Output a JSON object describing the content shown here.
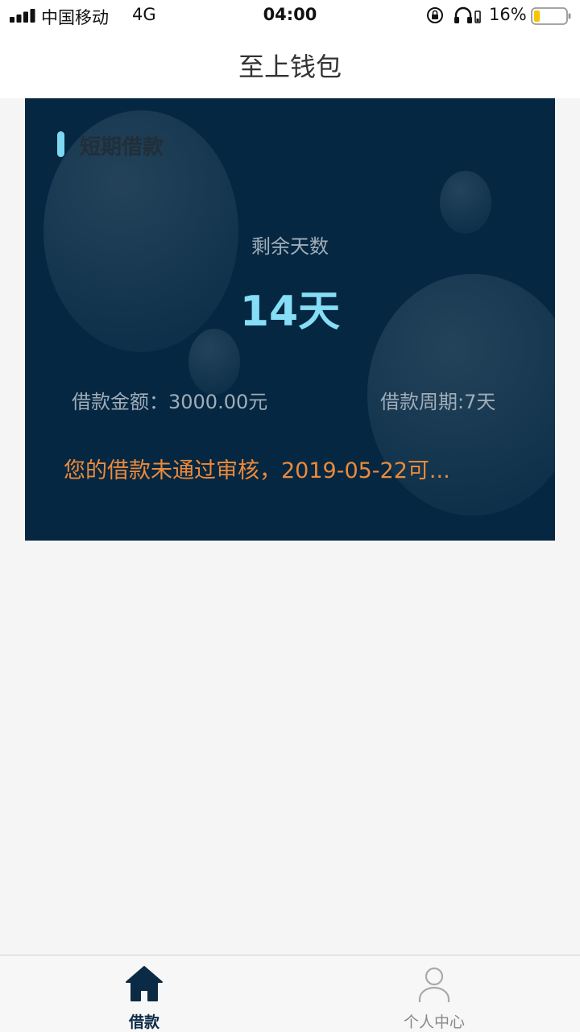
{
  "status_bar": {
    "carrier": "中国移动",
    "network": "4G",
    "time": "04:00",
    "battery": "16%"
  },
  "nav": {
    "title": "至上钱包"
  },
  "loan_card": {
    "tag": "短期借款",
    "remaining_label": "剩余天数",
    "remaining_value": "14天",
    "amount": "借款金额：3000.00元",
    "period": "借款周期:7天",
    "status": "您的借款未通过审核，2019-05-22可..."
  },
  "tabs": [
    {
      "label": "借款",
      "icon": "home-icon",
      "active": true
    },
    {
      "label": "个人中心",
      "icon": "user-icon",
      "active": false
    }
  ],
  "colors": {
    "card_background": "#052742",
    "accent": "#85def5",
    "warning": "#ec8a3a",
    "active_tab": "#0b2a45"
  }
}
